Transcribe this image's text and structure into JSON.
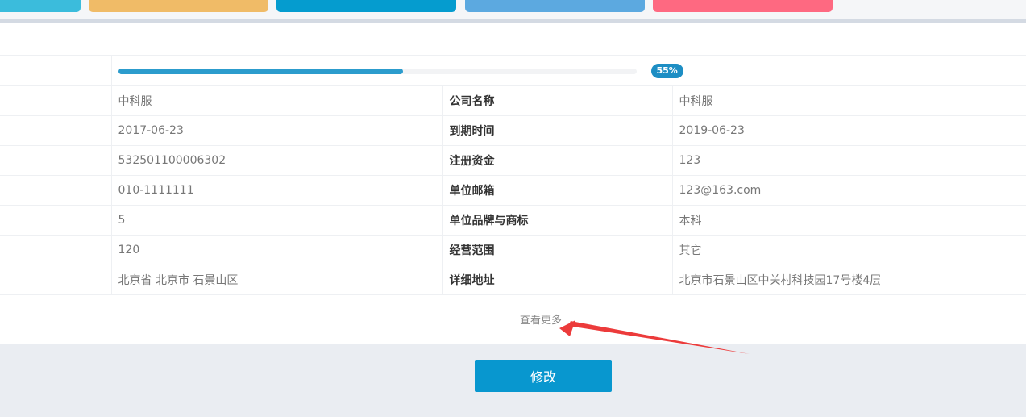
{
  "colors": {
    "accent": "#0897cf",
    "progress": "#2c9ccd",
    "tiles": [
      "#3bbcdc",
      "#f0bb67",
      "#059ccf",
      "#5ca9e0",
      "#fe6981"
    ],
    "annotation_arrow": "#ec3b3b"
  },
  "progress": {
    "value": 0.55,
    "label": "55%"
  },
  "rows": [
    {
      "value": "中科服",
      "label": "公司名称",
      "value2": "中科服"
    },
    {
      "value": "2017-06-23",
      "label": "到期时间",
      "value2": "2019-06-23"
    },
    {
      "value": "532501100006302",
      "label": "注册资金",
      "value2": "123"
    },
    {
      "value": "010-1111111",
      "label": "单位邮箱",
      "value2": "123@163.com"
    },
    {
      "value": "5",
      "label": "单位品牌与商标",
      "value2": "本科"
    },
    {
      "value": "120",
      "label": "经营范围",
      "value2": "其它"
    },
    {
      "value": "北京省 北京市 石景山区",
      "label": "详细地址",
      "value2": "北京市石景山区中关村科技园17号楼4层"
    }
  ],
  "more_link": "查看更多",
  "edit_button": "修改"
}
